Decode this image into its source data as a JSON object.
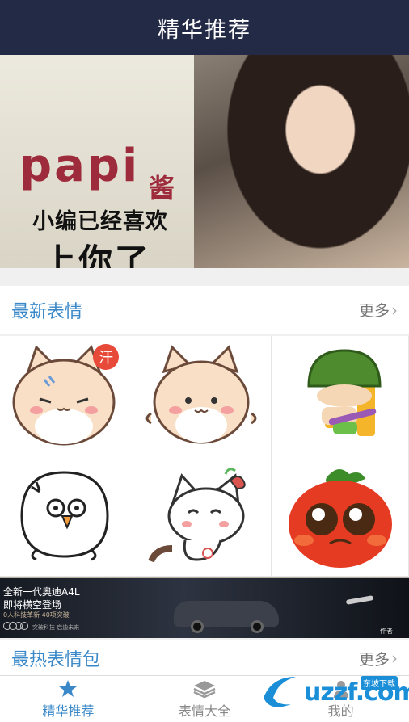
{
  "header": {
    "title": "精华推荐"
  },
  "banner": {
    "brand": "papi",
    "brand_suffix": "酱",
    "line1": "小编已经喜欢",
    "line2": "上你了",
    "slide_count": 2,
    "active_slide": 1,
    "active_dot_color": "#f29a1c"
  },
  "latest": {
    "title": "最新表情",
    "more": "更多"
  },
  "stickers": [
    {
      "icon": "sweating-hamster-icon",
      "badge": "汗"
    },
    {
      "icon": "happy-hamster-icon"
    },
    {
      "icon": "soldier-boy-on-chair-icon"
    },
    {
      "icon": "angry-white-bird-icon"
    },
    {
      "icon": "white-cat-with-bow-icon"
    },
    {
      "icon": "crying-tomato-icon"
    }
  ],
  "ad": {
    "line1": "全新一代奥迪A4L",
    "line2": "即将横空登场",
    "line3": "0人科技革新 40项突破",
    "tagline": "突破科技 启迪未来",
    "corner": "作者"
  },
  "hot": {
    "title": "最热表情包",
    "more": "更多"
  },
  "tabs": [
    {
      "label": "精华推荐",
      "icon": "star-icon",
      "active": true
    },
    {
      "label": "表情大全",
      "icon": "layers-icon",
      "active": false
    },
    {
      "label": "我的",
      "icon": "person-icon",
      "active": false
    }
  ],
  "watermark": {
    "text": "uzzf.com",
    "badge": "东坡下载"
  },
  "colors": {
    "header": "#232a45",
    "accent": "#3a88c8"
  }
}
